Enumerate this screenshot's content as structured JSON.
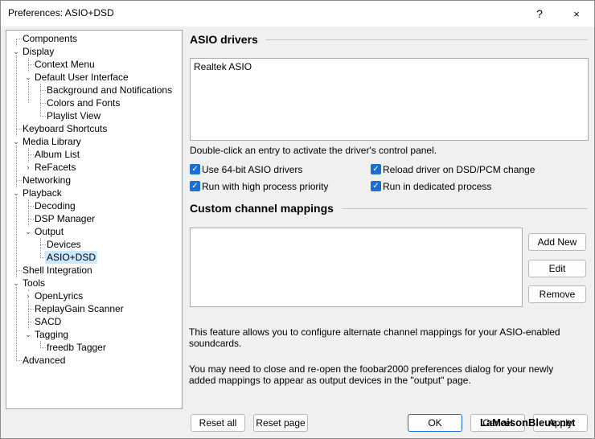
{
  "window": {
    "title": "Preferences: ASIO+DSD",
    "help_icon": "?",
    "close_icon": "×"
  },
  "tree": {
    "items": [
      {
        "label": "Components"
      },
      {
        "label": "Display"
      },
      {
        "label": "Context Menu"
      },
      {
        "label": "Default User Interface"
      },
      {
        "label": "Background and Notifications"
      },
      {
        "label": "Colors and Fonts"
      },
      {
        "label": "Playlist View"
      },
      {
        "label": "Keyboard Shortcuts"
      },
      {
        "label": "Media Library"
      },
      {
        "label": "Album List"
      },
      {
        "label": "ReFacets"
      },
      {
        "label": "Networking"
      },
      {
        "label": "Playback"
      },
      {
        "label": "Decoding"
      },
      {
        "label": "DSP Manager"
      },
      {
        "label": "Output"
      },
      {
        "label": "Devices"
      },
      {
        "label": "ASIO+DSD",
        "selected": true
      },
      {
        "label": "Shell Integration"
      },
      {
        "label": "Tools"
      },
      {
        "label": "OpenLyrics"
      },
      {
        "label": "ReplayGain Scanner"
      },
      {
        "label": "SACD"
      },
      {
        "label": "Tagging"
      },
      {
        "label": "freedb Tagger"
      },
      {
        "label": "Advanced"
      }
    ]
  },
  "asio": {
    "heading": "ASIO drivers",
    "drivers": [
      "Realtek ASIO"
    ],
    "hint": "Double-click an entry to activate the driver's control panel.",
    "options": [
      {
        "label": "Use 64-bit ASIO drivers",
        "checked": true
      },
      {
        "label": "Reload driver on DSD/PCM change",
        "checked": true
      },
      {
        "label": "Run with high process priority",
        "checked": true
      },
      {
        "label": "Run in dedicated process",
        "checked": true
      }
    ]
  },
  "mappings": {
    "heading": "Custom channel mappings",
    "add_label": "Add New",
    "edit_label": "Edit",
    "remove_label": "Remove",
    "info1_line1": "This feature allows you to configure alternate channel mappings for your ASIO-enabled",
    "info1_line2": "soundcards.",
    "info2_line1": "You may need to close and re-open the foobar2000 preferences dialog for your newly",
    "info2_line2": "added mappings to appear as output devices in the \"output\" page."
  },
  "footer": {
    "reset_all": "Reset all",
    "reset_page": "Reset page",
    "ok": "OK",
    "cancel": "Cancel",
    "apply": "Apply"
  },
  "watermark": "LaMaisonBleue.net",
  "colors": {
    "accent": "#1c6fd1",
    "selection": "#cce8ff"
  }
}
